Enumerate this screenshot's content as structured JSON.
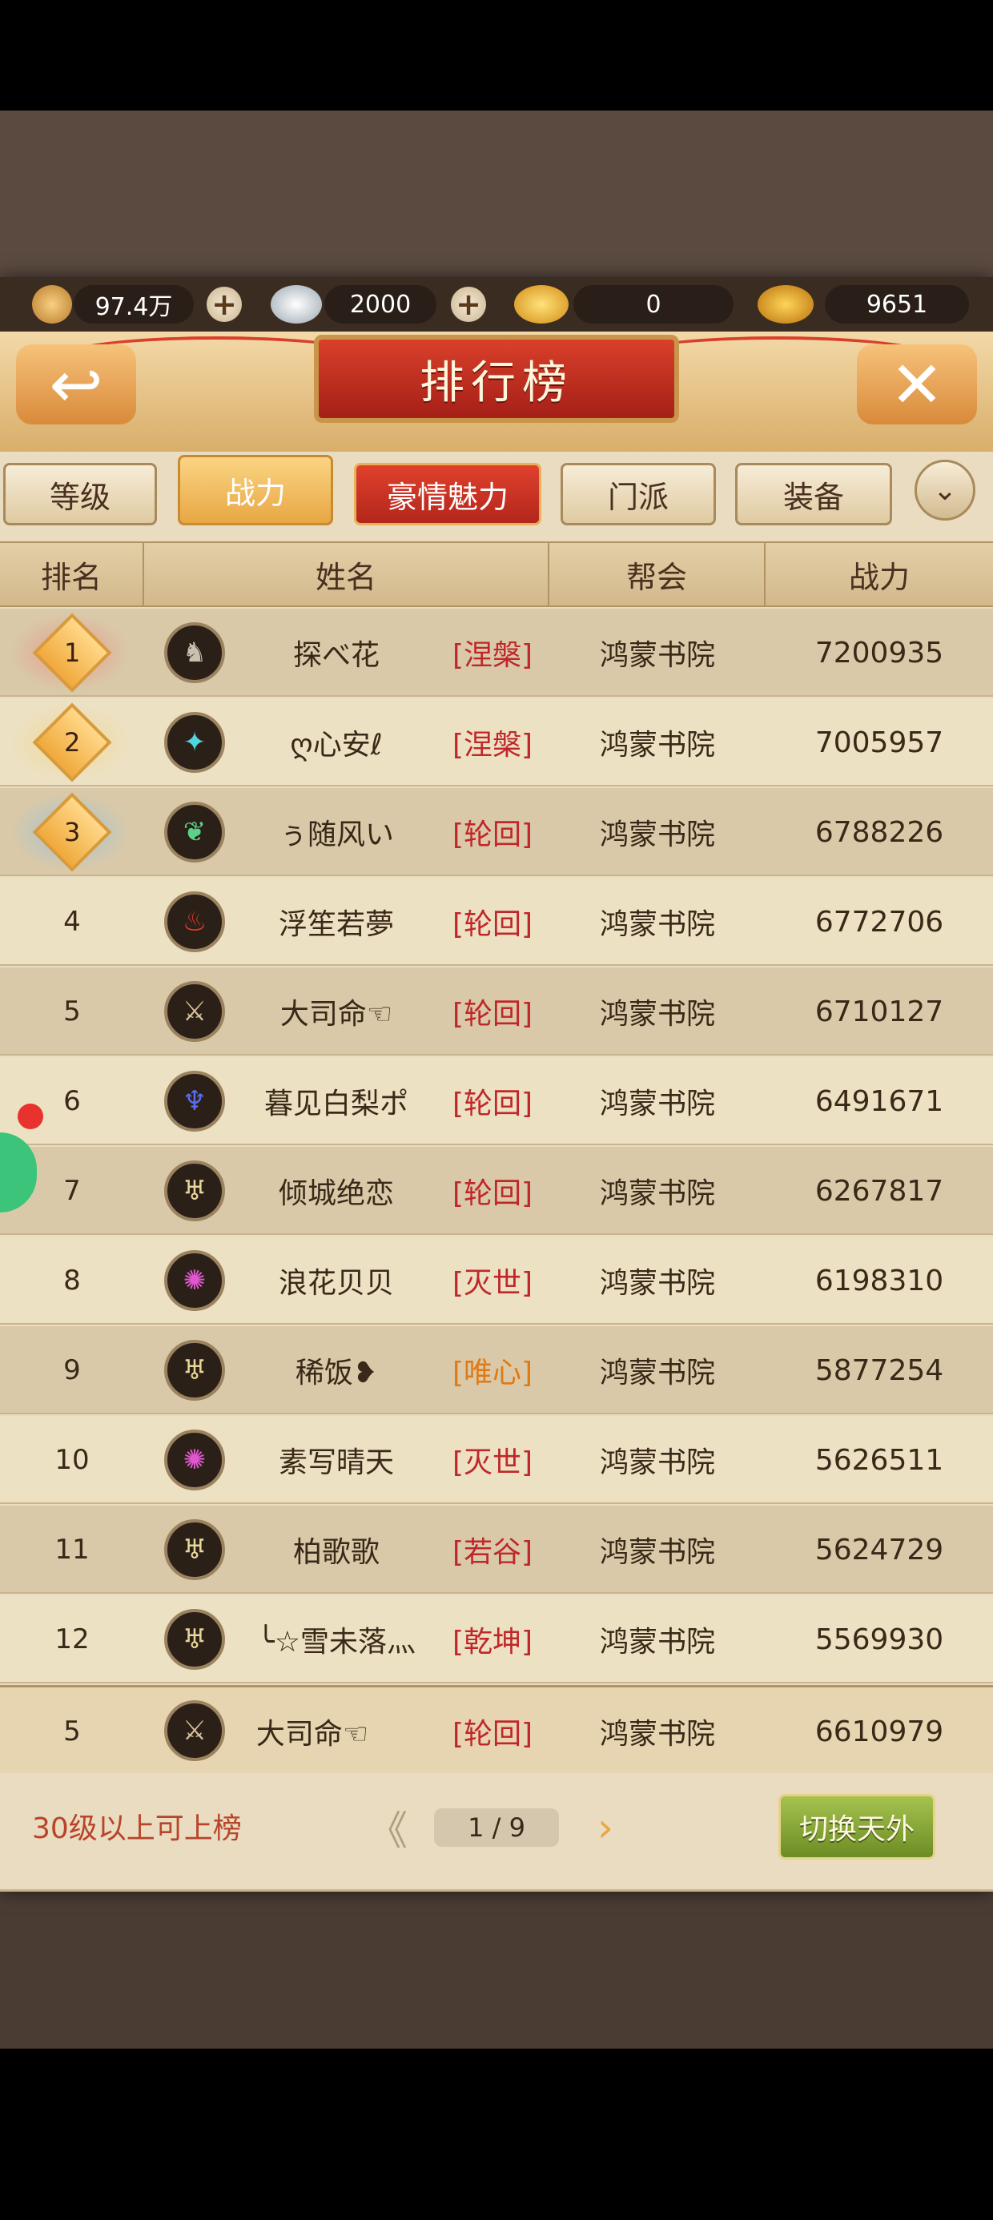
{
  "currency": [
    {
      "icon": "copper-coin-icon",
      "value": "97.4万",
      "has_plus": true
    },
    {
      "icon": "silver-ingot-icon",
      "value": "2000",
      "has_plus": true
    },
    {
      "icon": "gold-ingot-icon",
      "value": "0",
      "has_plus": false
    },
    {
      "icon": "locked-gold-ingot-icon",
      "value": "9651",
      "has_plus": false
    }
  ],
  "header": {
    "title": "排行榜",
    "back_symbol": "↩",
    "close_symbol": "✕"
  },
  "tabs": [
    {
      "label": "等级",
      "state": "normal"
    },
    {
      "label": "战力",
      "state": "active"
    },
    {
      "label": "豪情魅力",
      "state": "special"
    },
    {
      "label": "门派",
      "state": "normal"
    },
    {
      "label": "装备",
      "state": "normal"
    }
  ],
  "dropdown_symbol": "⌄",
  "columns": [
    "排名",
    "姓名",
    "帮会",
    "战力"
  ],
  "rows": [
    {
      "rank": "1",
      "name": "探べ花",
      "sect": "[涅槃]",
      "sect_color": "red",
      "guild": "鸿蒙书院",
      "power": "7200935",
      "avatar_icon": "dragon-emblem-icon",
      "avatar_color": "#c9c0b0"
    },
    {
      "rank": "2",
      "name": "ღ心安ℓ",
      "sect": "[涅槃]",
      "sect_color": "red",
      "guild": "鸿蒙书院",
      "power": "7005957",
      "avatar_icon": "feather-emblem-icon",
      "avatar_color": "#4fd6e0"
    },
    {
      "rank": "3",
      "name": "ぅ随风い",
      "sect": "[轮回]",
      "sect_color": "red",
      "guild": "鸿蒙书院",
      "power": "6788226",
      "avatar_icon": "leaf-emblem-icon",
      "avatar_color": "#5ad28a"
    },
    {
      "rank": "4",
      "name": "浮笙若夢",
      "sect": "[轮回]",
      "sect_color": "red",
      "guild": "鸿蒙书院",
      "power": "6772706",
      "avatar_icon": "flame-emblem-icon",
      "avatar_color": "#e23a2a"
    },
    {
      "rank": "5",
      "name": "大司命☜",
      "sect": "[轮回]",
      "sect_color": "red",
      "guild": "鸿蒙书院",
      "power": "6710127",
      "avatar_icon": "blade-emblem-icon",
      "avatar_color": "#d8c49a"
    },
    {
      "rank": "6",
      "name": "暮见白梨ポ",
      "sect": "[轮回]",
      "sect_color": "red",
      "guild": "鸿蒙书院",
      "power": "6491671",
      "avatar_icon": "trident-emblem-icon",
      "avatar_color": "#5a6cf0"
    },
    {
      "rank": "7",
      "name": "倾城绝恋",
      "sect": "[轮回]",
      "sect_color": "red",
      "guild": "鸿蒙书院",
      "power": "6267817",
      "avatar_icon": "wing-emblem-icon",
      "avatar_color": "#e8d69a"
    },
    {
      "rank": "8",
      "name": "浪花贝贝",
      "sect": "[灭世]",
      "sect_color": "red",
      "guild": "鸿蒙书院",
      "power": "6198310",
      "avatar_icon": "swirl-emblem-icon",
      "avatar_color": "#e058d0"
    },
    {
      "rank": "9",
      "name": "稀饭❥",
      "sect": "[唯心]",
      "sect_color": "orange",
      "guild": "鸿蒙书院",
      "power": "5877254",
      "avatar_icon": "wing-emblem-icon",
      "avatar_color": "#e8d69a"
    },
    {
      "rank": "10",
      "name": "素写晴天",
      "sect": "[灭世]",
      "sect_color": "red",
      "guild": "鸿蒙书院",
      "power": "5626511",
      "avatar_icon": "swirl-emblem-icon",
      "avatar_color": "#e058d0"
    },
    {
      "rank": "11",
      "name": "柏歌歌",
      "sect": "[若谷]",
      "sect_color": "red",
      "guild": "鸿蒙书院",
      "power": "5624729",
      "avatar_icon": "wing-emblem-icon",
      "avatar_color": "#e8d69a"
    },
    {
      "rank": "12",
      "name": "╰☆雪未落灬",
      "sect": "[乾坤]",
      "sect_color": "red",
      "guild": "鸿蒙书院",
      "power": "5569930",
      "avatar_icon": "wing-emblem-icon",
      "avatar_color": "#e8d69a"
    }
  ],
  "self_row": {
    "rank": "5",
    "name": "大司命☜",
    "sect": "[轮回]",
    "sect_color": "red",
    "guild": "鸿蒙书院",
    "power": "6610979",
    "avatar_icon": "blade-emblem-icon",
    "avatar_color": "#d8c49a"
  },
  "footer": {
    "hint": "30级以上可上榜",
    "page": "1 / 9",
    "prev_symbol": "《",
    "next_symbol": "›",
    "switch_label": "切换天外"
  }
}
